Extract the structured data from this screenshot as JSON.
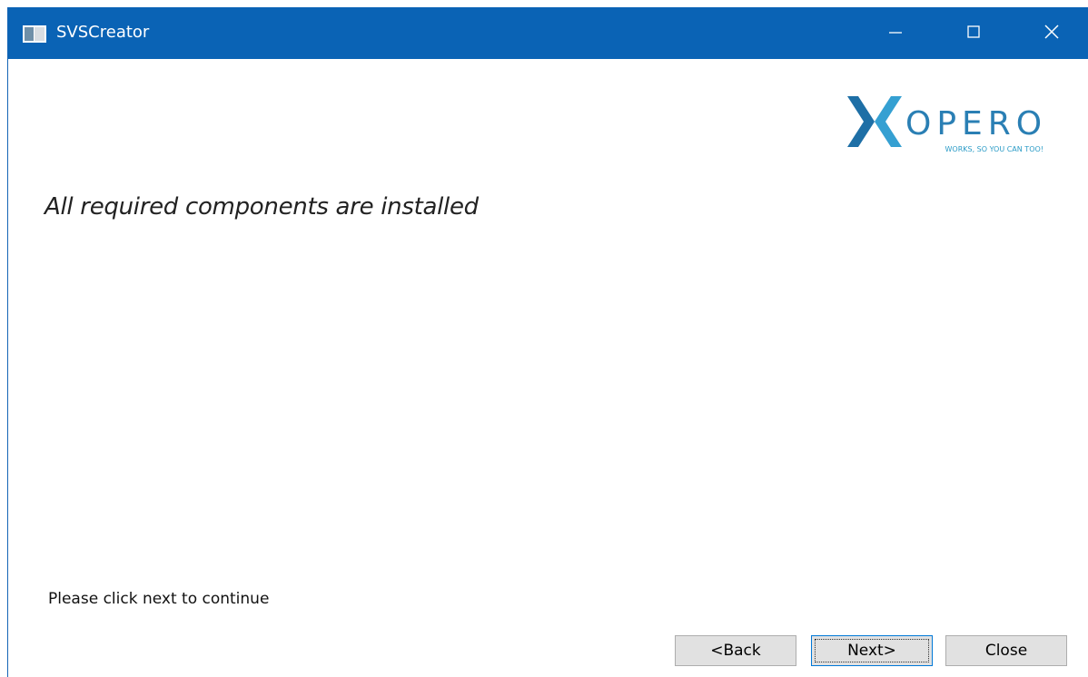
{
  "window": {
    "title": "SVSCreator",
    "icons": {
      "app": "app-window-icon",
      "minimize": "minimize-icon",
      "maximize": "maximize-icon",
      "close": "close-icon"
    }
  },
  "logo": {
    "brand_prefix": "X",
    "brand_rest": "OPERO",
    "tagline": "WORKS, SO YOU CAN TOO!",
    "colors": {
      "x": "#1d7ec3",
      "wordmark": "#2a7fb4",
      "tagline": "#2c9cc7"
    }
  },
  "content": {
    "heading": "All required components are installed",
    "instruction": "Please click next to continue"
  },
  "buttons": {
    "back": "<Back",
    "next": "Next>",
    "close": "Close"
  },
  "colors": {
    "titlebar": "#0a63b5",
    "button_face": "#e1e1e1",
    "focus_border": "#0078d7"
  }
}
